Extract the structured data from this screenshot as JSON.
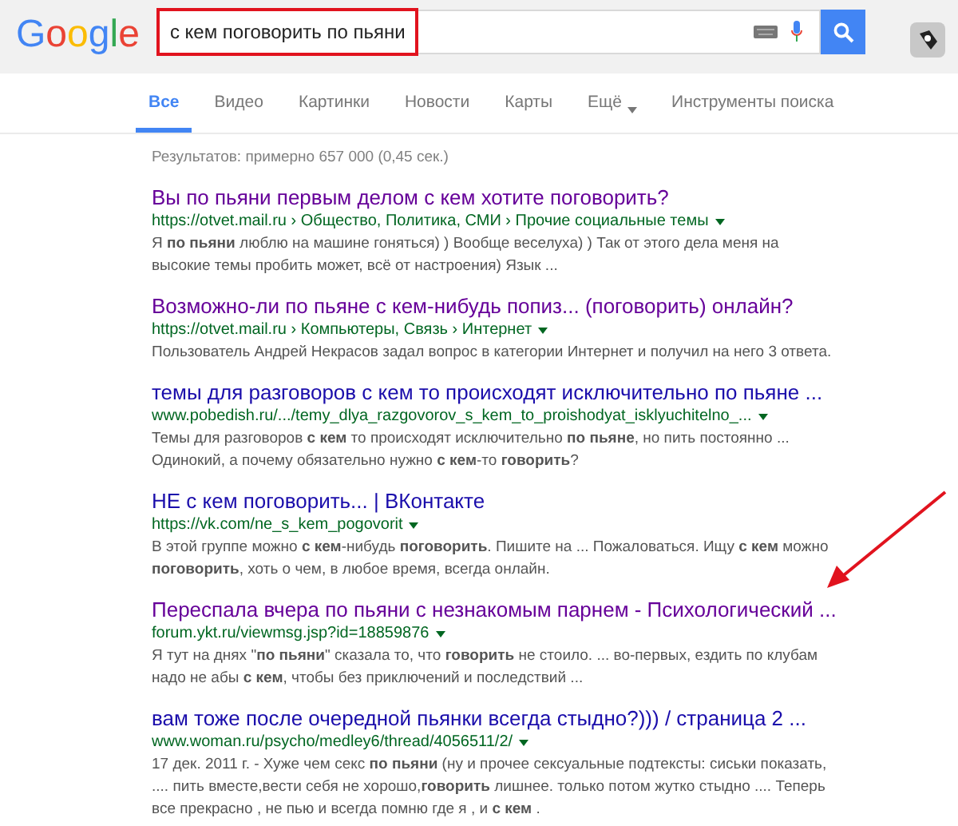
{
  "logo": "Google",
  "search": {
    "value": "с кем поговорить по пьяни",
    "highlighted": true
  },
  "tabs": [
    {
      "label": "Все",
      "selected": true,
      "kind": "tab"
    },
    {
      "label": "Видео",
      "selected": false,
      "kind": "tab"
    },
    {
      "label": "Картинки",
      "selected": false,
      "kind": "tab"
    },
    {
      "label": "Новости",
      "selected": false,
      "kind": "tab"
    },
    {
      "label": "Карты",
      "selected": false,
      "kind": "tab"
    },
    {
      "label": "Ещё",
      "selected": false,
      "kind": "menu"
    },
    {
      "label": "Инструменты поиска",
      "selected": false,
      "kind": "tab"
    }
  ],
  "result_stats": "Результатов: примерно 657 000 (0,45 сек.)",
  "results": [
    {
      "title": "Вы по пьяни первым делом с кем хотите поговорить?",
      "visited": true,
      "url": "https://otvet.mail.ru › Общество, Политика, СМИ › Прочие социальные темы",
      "snippet": "Я **по пьяни** люблю на машине гоняться) ) Вообще веселуха) ) Так от этого дела меня на высокие темы пробить может, всё от настроения) Язык ..."
    },
    {
      "title": "Возможно-ли по пьяне с кем-нибудь попиз... (поговорить) онлайн?",
      "visited": true,
      "url": "https://otvet.mail.ru › Компьютеры, Связь › Интернет",
      "snippet": "Пользователь Андрей Некрасов задал вопрос в категории Интернет и получил на него 3 ответа."
    },
    {
      "title": "темы для разговоров с кем то происходят исключительно по пьяне ...",
      "visited": false,
      "url": "www.pobedish.ru/.../temy_dlya_razgovorov_s_kem_to_proishodyat_isklyuchitelno_...",
      "snippet": "Темы для разговоров **с кем** то происходят исключительно **по пьяне**, но пить постоянно ... Одинокий, а почему обязательно нужно **с кем**-то **говорить**?"
    },
    {
      "title": "НЕ с кем поговорить... | ВКонтакте",
      "visited": false,
      "url": "https://vk.com/ne_s_kem_pogovorit",
      "snippet": "В этой группе можно **с кем**-нибудь **поговорить**. Пишите на ... Пожаловаться. Ищу **с кем** можно **поговорить**, хоть о чем, в любое время, всегда онлайн."
    },
    {
      "title": "Переспала вчера по пьяни с незнакомым парнем - Психологический ...",
      "visited": true,
      "url": "forum.ykt.ru/viewmsg.jsp?id=18859876",
      "snippet": "Я тут на днях \"**по пьяни**\" сказала то, что **говорить** не стоило. ... во-первых, ездить по клубам надо не абы **с кем**, чтобы без приключений и последствий ..."
    },
    {
      "title": "вам тоже после очередной пьянки всегда стыдно?))) / страница 2 ...",
      "visited": false,
      "url": "www.woman.ru/psycho/medley6/thread/4056511/2/",
      "snippet": "17 дек. 2011 г. - Хуже чем секс **по пьяни** (ну и прочее сексуальные подтексты: сиськи показать, .... пить вместе,вести себя не хорошо,**говорить** лишнее. только потом жутко стыдно .... Теперь все прекрасно , не пью и всегда помню где я , и **с кем** ."
    }
  ]
}
